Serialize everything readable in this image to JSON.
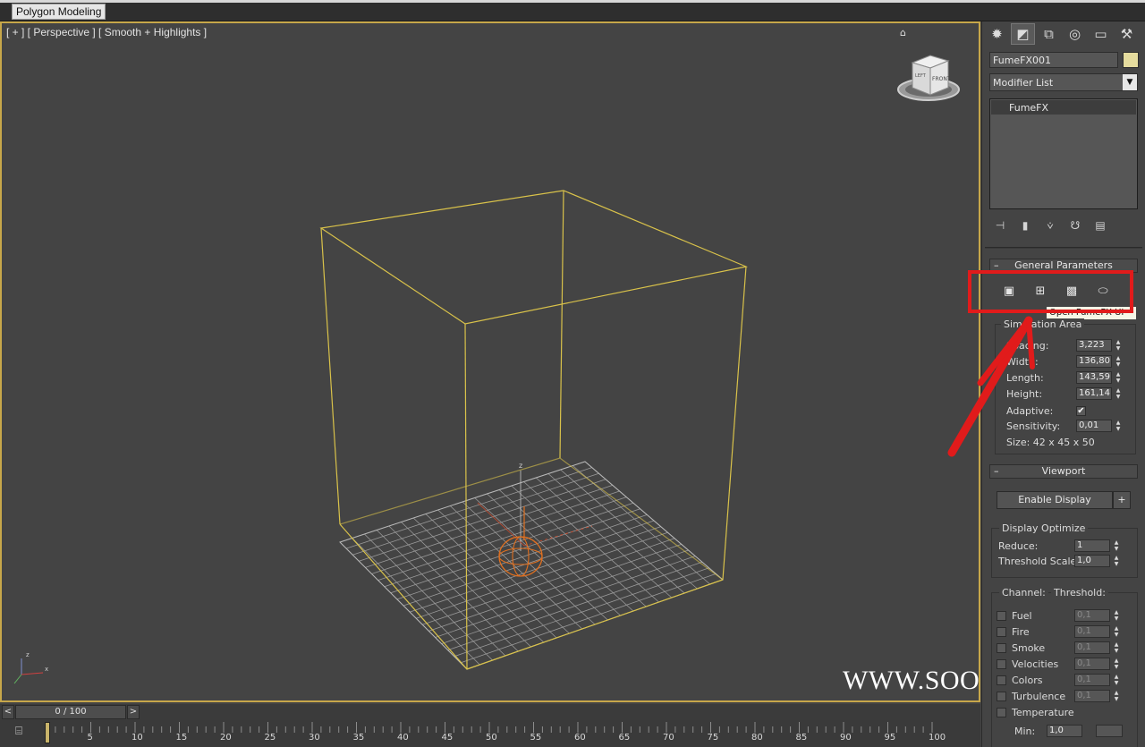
{
  "ribbon": {
    "tab_label": "Polygon Modeling"
  },
  "viewport": {
    "label": "[ + ] [ Perspective ] [ Smooth + Highlights ]",
    "viewcube_face": "FRONT",
    "viewcube_face_side": "LEFT",
    "axis_z": "z",
    "axis_x": "x"
  },
  "watermark": "WWW.SOOHAR.RU",
  "command_panel": {
    "tabs": [
      "create-icon",
      "modify-icon",
      "hierarchy-icon",
      "motion-icon",
      "display-icon",
      "utilities-icon"
    ],
    "object_name": "FumeFX001",
    "object_color": "#e5dc9e",
    "modifier_list_label": "Modifier List",
    "stack_items": [
      "FumeFX"
    ],
    "general_parameters": {
      "title": "General Parameters",
      "tooltip": "Open FumeFX UI",
      "simulation_area": {
        "title": "Simulation Area",
        "spacing": {
          "label": "Spacing:",
          "value": "3,223"
        },
        "width": {
          "label": "Width:",
          "value": "136,80"
        },
        "length": {
          "label": "Length:",
          "value": "143,59"
        },
        "height": {
          "label": "Height:",
          "value": "161,14"
        },
        "adaptive": {
          "label": "Adaptive:",
          "checked": true,
          "mark": "✔"
        },
        "sensitivity": {
          "label": "Sensitivity:",
          "value": "0,01"
        },
        "size": "Size:  42 x 45 x 50"
      }
    },
    "viewport_rollout": {
      "title": "Viewport",
      "enable_display": "Enable Display",
      "plus": "+",
      "display_optimize": {
        "title": "Display Optimize",
        "reduce": {
          "label": "Reduce:",
          "value": "1"
        },
        "threshold_scale": {
          "label": "Threshold Scale:",
          "value": "1,0"
        }
      },
      "channel_header": "Channel:",
      "threshold_header": "Threshold:",
      "channels": [
        {
          "label": "Fuel",
          "value": "0,1"
        },
        {
          "label": "Fire",
          "value": "0,1"
        },
        {
          "label": "Smoke",
          "value": "0,1"
        },
        {
          "label": "Velocities",
          "value": "0,1"
        },
        {
          "label": "Colors",
          "value": "0,1"
        },
        {
          "label": "Turbulence",
          "value": "0,1"
        },
        {
          "label": "Temperature",
          "value": ""
        }
      ],
      "min_label": "Min:",
      "min_value": "1,0"
    }
  },
  "timeline": {
    "slider_text": "0 / 100",
    "prev": "<",
    "next": ">",
    "ticks": [
      "5",
      "10",
      "15",
      "20",
      "25",
      "30",
      "35",
      "40",
      "45",
      "50",
      "55",
      "60",
      "65",
      "70",
      "75",
      "80",
      "85",
      "90",
      "95",
      "100"
    ]
  }
}
